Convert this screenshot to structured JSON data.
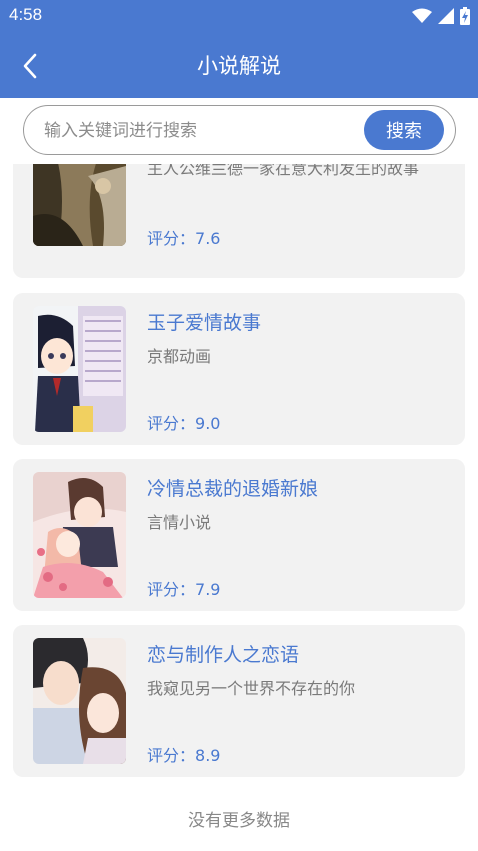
{
  "status_bar": {
    "time": "4:58"
  },
  "header": {
    "title": "小说解说"
  },
  "search": {
    "placeholder": "输入关键词进行搜索",
    "button_label": "搜索"
  },
  "novels": [
    {
      "title": "",
      "description": "主人公维兰德一家在意大利发生的故事",
      "rating_label": "评分：",
      "rating": "7.6"
    },
    {
      "title": "玉子爱情故事",
      "description": "京都动画",
      "rating_label": "评分：",
      "rating": "9.0"
    },
    {
      "title": "冷情总裁的退婚新娘",
      "description": "言情小说",
      "rating_label": "评分：",
      "rating": "7.9"
    },
    {
      "title": "恋与制作人之恋语",
      "description": "我窥见另一个世界不存在的你",
      "rating_label": "评分：",
      "rating": "8.9"
    }
  ],
  "footer": {
    "no_more": "没有更多数据"
  },
  "colors": {
    "accent": "#4a79d0",
    "card_bg": "#f2f2f2",
    "secondary_text": "#7a7a7a"
  }
}
